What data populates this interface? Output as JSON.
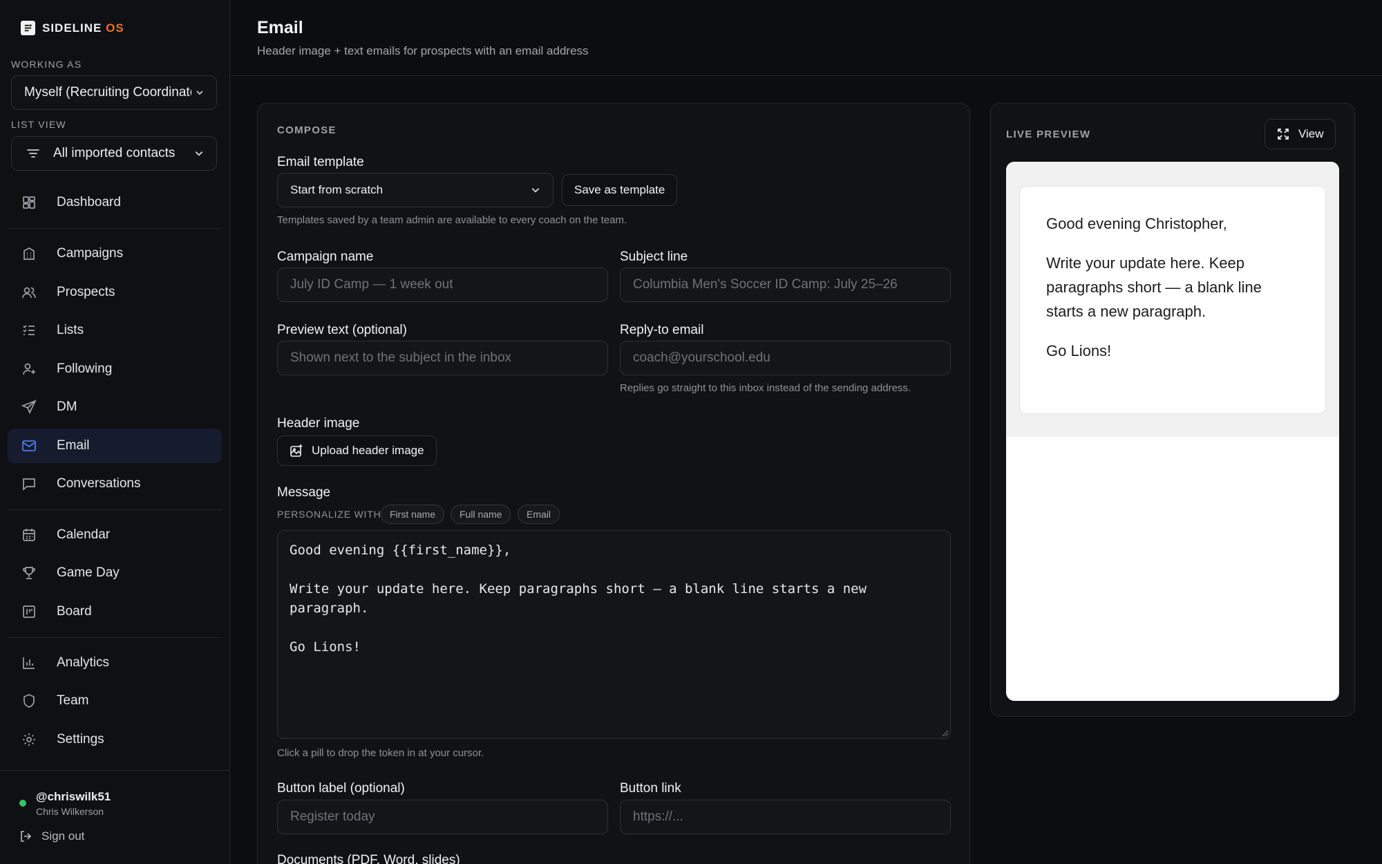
{
  "brand": {
    "name": "SIDELINE",
    "suffix": "OS",
    "accent": "#e8742b"
  },
  "sidebar": {
    "working_as_label": "WORKING AS",
    "working_as_value": "Myself (Recruiting Coordinator)",
    "list_view_label": "LIST VIEW",
    "list_view_value": "All imported contacts",
    "items": [
      {
        "label": "Dashboard",
        "icon": "dashboard-icon"
      },
      {
        "label": "Campaigns",
        "icon": "building-icon"
      },
      {
        "label": "Prospects",
        "icon": "users-icon"
      },
      {
        "label": "Lists",
        "icon": "list-check-icon"
      },
      {
        "label": "Following",
        "icon": "user-plus-icon"
      },
      {
        "label": "DM",
        "icon": "send-icon"
      },
      {
        "label": "Email",
        "icon": "mail-icon",
        "active": true
      },
      {
        "label": "Conversations",
        "icon": "chat-icon"
      },
      {
        "label": "Calendar",
        "icon": "calendar-icon"
      },
      {
        "label": "Game Day",
        "icon": "trophy-icon"
      },
      {
        "label": "Board",
        "icon": "board-icon"
      },
      {
        "label": "Analytics",
        "icon": "bar-chart-icon"
      },
      {
        "label": "Team",
        "icon": "shield-icon"
      },
      {
        "label": "Settings",
        "icon": "gear-icon"
      }
    ],
    "user": {
      "handle": "@chriswilk51",
      "name": "Chris Wilkerson",
      "status_color": "#2fc56a"
    },
    "sign_out": "Sign out"
  },
  "header": {
    "title": "Email",
    "subtitle": "Header image + text emails for prospects with an email address"
  },
  "compose": {
    "section_label": "COMPOSE",
    "template_label": "Email template",
    "template_value": "Start from scratch",
    "save_template": "Save as template",
    "template_hint": "Templates saved by a team admin are available to every coach on the team.",
    "campaign_name_label": "Campaign name",
    "campaign_name_placeholder": "July ID Camp — 1 week out",
    "subject_label": "Subject line",
    "subject_placeholder": "Columbia Men's Soccer ID Camp: July 25–26",
    "preview_text_label": "Preview text (optional)",
    "preview_text_placeholder": "Shown next to the subject in the inbox",
    "reply_to_label": "Reply-to email",
    "reply_to_placeholder": "coach@yourschool.edu",
    "reply_to_hint": "Replies go straight to this inbox instead of the sending address.",
    "header_image_label": "Header image",
    "upload_button": "Upload header image",
    "message_label": "Message",
    "personalize_label": "PERSONALIZE WITH",
    "pills": [
      "First name",
      "Full name",
      "Email"
    ],
    "message_body": "Good evening {{first_name}},\n\nWrite your update here. Keep paragraphs short — a blank line starts a new paragraph.\n\nGo Lions!",
    "message_hint": "Click a pill to drop the token in at your cursor.",
    "button_label_label": "Button label (optional)",
    "button_label_placeholder": "Register today",
    "button_link_label": "Button link",
    "button_link_placeholder": "https://...",
    "documents_label": "Documents (PDF, Word, slides)"
  },
  "preview": {
    "section_label": "LIVE PREVIEW",
    "view_button": "View",
    "paragraphs": [
      "Good evening Christopher,",
      "Write your update here. Keep paragraphs short — a blank line starts a new paragraph.",
      "Go Lions!"
    ]
  }
}
